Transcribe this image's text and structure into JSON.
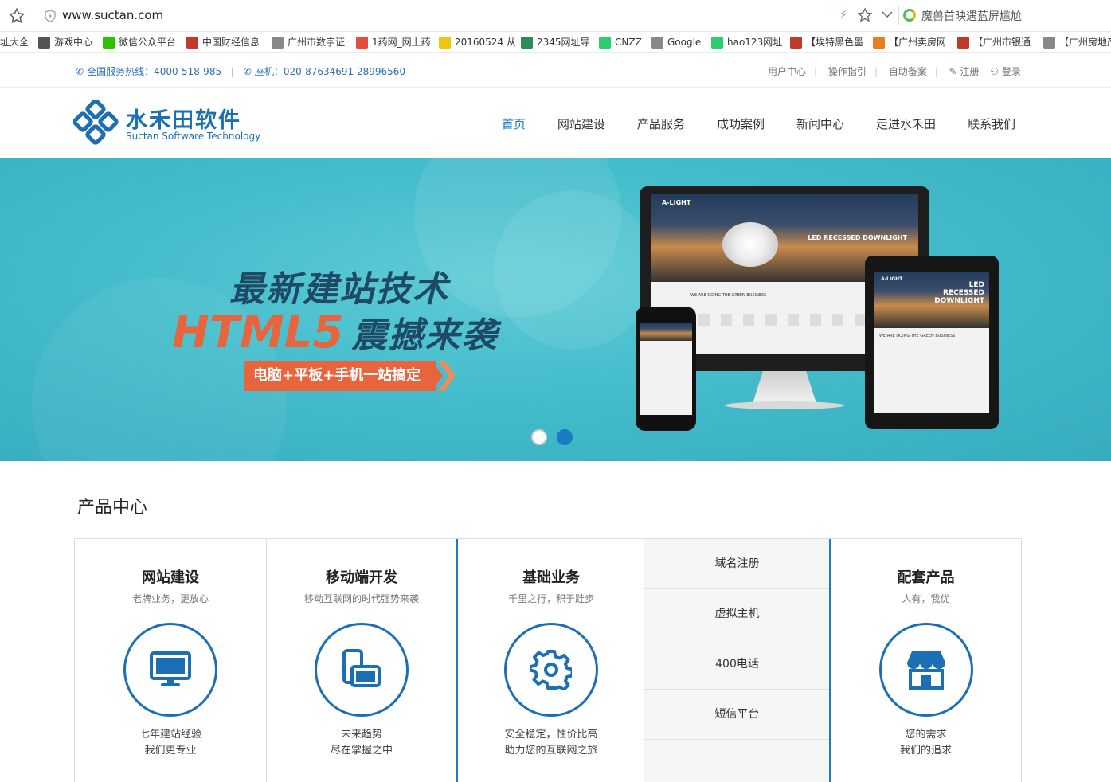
{
  "browser": {
    "url": "www.suctan.com",
    "search_text": "魔兽首映遇蓝屏尴尬",
    "bookmarks": [
      {
        "label": "址大全",
        "icon": "page-icon",
        "color": "#888888"
      },
      {
        "label": "游戏中心",
        "icon": "gamepad-icon",
        "color": "#555555"
      },
      {
        "label": "微信公众平台",
        "icon": "wechat-icon",
        "color": "#2dc100"
      },
      {
        "label": "中国财经信息",
        "icon": "cfi-icon",
        "color": "#c0392b"
      },
      {
        "label": "广州市数字证",
        "icon": "page-icon",
        "color": "#888888"
      },
      {
        "label": "1药网_网上药",
        "icon": "pill-icon",
        "color": "#e74c3c"
      },
      {
        "label": "20160524 从",
        "icon": "folder-icon",
        "color": "#f1c40f"
      },
      {
        "label": "2345网址导",
        "icon": "2345-icon",
        "color": "#2e8b57"
      },
      {
        "label": "CNZZ",
        "icon": "cnzz-icon",
        "color": "#2ecc71"
      },
      {
        "label": "Google",
        "icon": "page-icon",
        "color": "#888888"
      },
      {
        "label": "hao123网址",
        "icon": "hao123-icon",
        "color": "#2ecc71"
      },
      {
        "label": "【埃特黑色墨",
        "icon": "jd-icon",
        "color": "#c0392b"
      },
      {
        "label": "【广州卖房网",
        "icon": "house-icon",
        "color": "#e67e22"
      },
      {
        "label": "【广州市银通",
        "icon": "bank-icon",
        "color": "#c0392b"
      },
      {
        "label": "【广州房地产",
        "icon": "page-icon",
        "color": "#888888"
      }
    ]
  },
  "topbar": {
    "hotline_label": "全国服务热线：",
    "hotline_number": "4000-518-985",
    "sep": "|",
    "landline_label": "座机：",
    "landline_number": "020-87634691 28996560",
    "links": [
      "用户中心",
      "操作指引",
      "自助备案"
    ],
    "register": "注册",
    "login": "登录"
  },
  "header": {
    "logo_cn": "水禾田软件",
    "logo_en": "Suctan Software Technology",
    "nav": [
      "首页",
      "网站建设",
      "产品服务",
      "成功案例",
      "新闻中心",
      "走进水禾田",
      "联系我们"
    ],
    "active_nav": "首页"
  },
  "banner": {
    "title_line1": "最新建站技术",
    "title_html5": "HTML5",
    "title_rest": "震撼来袭",
    "ribbon": "电脑+平板+手机一站搞定",
    "slides": 2,
    "active_slide": 2,
    "screen_logo": "A-LIGHT",
    "screen_headline": "LED RECESSED DOWNLIGHT",
    "screen_tag": "WE ARE DOING THE GREEN BUSINESS"
  },
  "products": {
    "section_title": "产品中心",
    "columns": [
      {
        "title": "网站建设",
        "subtitle": "老牌业务，更放心",
        "icon": "monitor-icon",
        "desc1": "七年建站经验",
        "desc2": "我们更专业"
      },
      {
        "title": "移动端开发",
        "subtitle": "移动互联网的时代强势来袭",
        "icon": "mobile-tablet-icon",
        "desc1": "未来趋势",
        "desc2": "尽在掌握之中"
      },
      {
        "title": "基础业务",
        "subtitle": "千里之行，积于跬步",
        "icon": "gear-icon",
        "desc1": "安全稳定，性价比高",
        "desc2": "助力您的互联网之旅"
      },
      {
        "title": "配套产品",
        "subtitle": "人有，我优",
        "icon": "store-icon",
        "desc1": "您的需求",
        "desc2": "我们的追求"
      }
    ],
    "services": [
      "域名注册",
      "虚拟主机",
      "400电话",
      "短信平台"
    ]
  },
  "colors": {
    "brand_blue": "#1a6fb5",
    "accent_orange": "#e8643c",
    "banner_teal": "#44bccb"
  }
}
